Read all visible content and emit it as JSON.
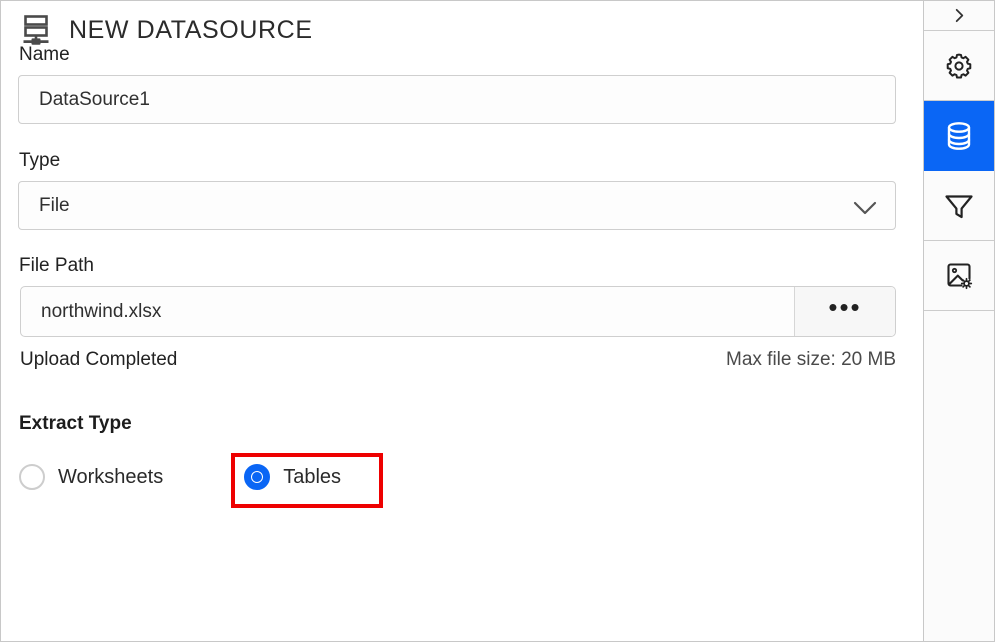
{
  "header": {
    "title": "NEW DATASOURCE",
    "icon": "datasource-icon"
  },
  "form": {
    "name": {
      "label": "Name",
      "value": "DataSource1",
      "placeholder": "Name"
    },
    "type": {
      "label": "Type",
      "value": "File",
      "options": [
        "File"
      ],
      "chevron_icon": "chevron-down-icon"
    },
    "file_path": {
      "label": "File Path",
      "value": "northwind.xlsx",
      "placeholder": "File Path",
      "browse_label": "•••",
      "browse_icon": "ellipsis-icon"
    },
    "upload_status": "Upload Completed",
    "max_file_size": "Max file size: 20 MB",
    "extract_type": {
      "label": "Extract Type",
      "options": [
        {
          "label": "Worksheets",
          "selected": false
        },
        {
          "label": "Tables",
          "selected": true
        }
      ]
    }
  },
  "sidebar": {
    "items": [
      {
        "name": "expand-panel",
        "icon": "chevron-right-icon",
        "active": false
      },
      {
        "name": "settings",
        "icon": "gear-icon",
        "active": false
      },
      {
        "name": "datasource",
        "icon": "database-icon",
        "active": true
      },
      {
        "name": "filter",
        "icon": "funnel-icon",
        "active": false
      },
      {
        "name": "image-settings",
        "icon": "image-settings-icon",
        "active": false
      }
    ]
  },
  "colors": {
    "accent": "#0a66f5",
    "highlight": "#ee0000",
    "border": "#cfcfcf",
    "text": "#222222"
  }
}
